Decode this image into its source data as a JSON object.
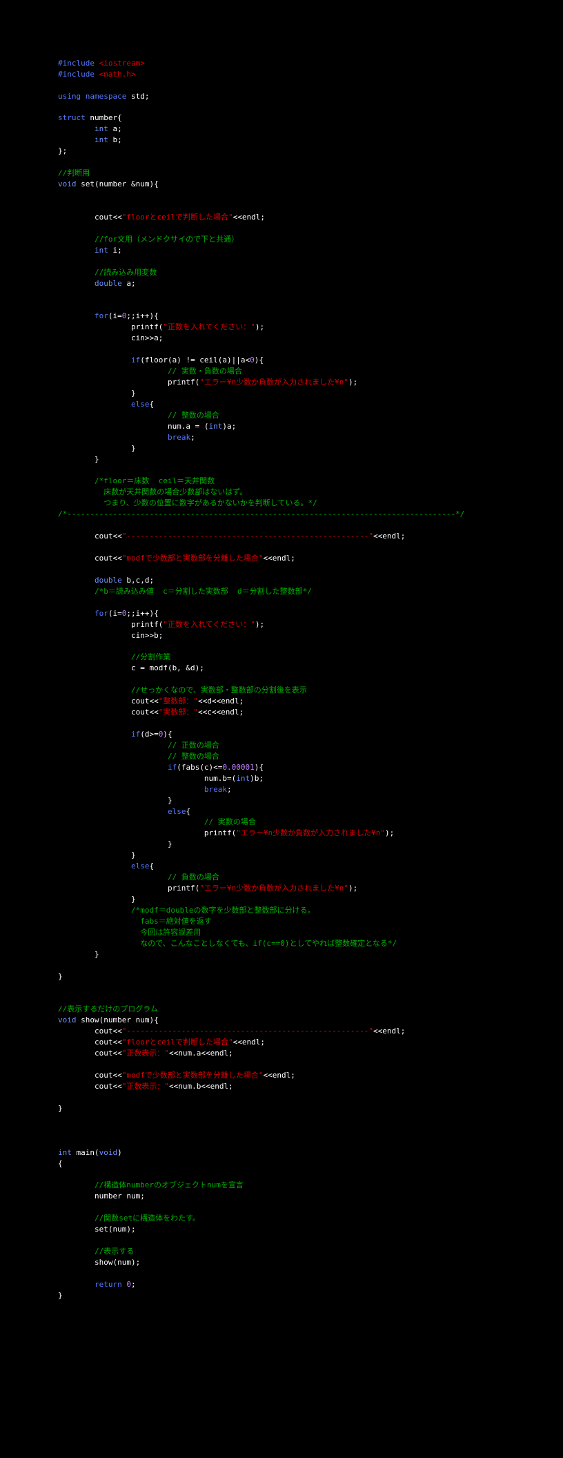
{
  "code": {
    "lines": [
      [
        {
          "c": "kw",
          "t": "#include"
        },
        {
          "c": "pl",
          "t": " "
        },
        {
          "c": "str",
          "t": "<iostream>"
        }
      ],
      [
        {
          "c": "kw",
          "t": "#include"
        },
        {
          "c": "pl",
          "t": " "
        },
        {
          "c": "str",
          "t": "<math.h>"
        }
      ],
      [],
      [
        {
          "c": "kw",
          "t": "using"
        },
        {
          "c": "pl",
          "t": " "
        },
        {
          "c": "kw",
          "t": "namespace"
        },
        {
          "c": "pl",
          "t": " std;"
        }
      ],
      [],
      [
        {
          "c": "kw",
          "t": "struct"
        },
        {
          "c": "pl",
          "t": " number{"
        }
      ],
      [
        {
          "c": "pl",
          "t": "        "
        },
        {
          "c": "kw2",
          "t": "int"
        },
        {
          "c": "pl",
          "t": " a;"
        }
      ],
      [
        {
          "c": "pl",
          "t": "        "
        },
        {
          "c": "kw2",
          "t": "int"
        },
        {
          "c": "pl",
          "t": " b;"
        }
      ],
      [
        {
          "c": "pl",
          "t": "};"
        }
      ],
      [],
      [
        {
          "c": "cmt",
          "t": "//判断用"
        }
      ],
      [
        {
          "c": "kw2",
          "t": "void"
        },
        {
          "c": "pl",
          "t": " set(number &num){"
        }
      ],
      [],
      [],
      [
        {
          "c": "pl",
          "t": "        cout<<"
        },
        {
          "c": "str",
          "t": "\"floorとceilで判断した場合\""
        },
        {
          "c": "pl",
          "t": "<<endl;"
        }
      ],
      [],
      [
        {
          "c": "pl",
          "t": "        "
        },
        {
          "c": "cmt",
          "t": "//for文用（メンドクサイので下と共通）"
        }
      ],
      [
        {
          "c": "pl",
          "t": "        "
        },
        {
          "c": "kw2",
          "t": "int"
        },
        {
          "c": "pl",
          "t": " i;"
        }
      ],
      [],
      [
        {
          "c": "pl",
          "t": "        "
        },
        {
          "c": "cmt",
          "t": "//読み込み用変数"
        }
      ],
      [
        {
          "c": "pl",
          "t": "        "
        },
        {
          "c": "kw2",
          "t": "double"
        },
        {
          "c": "pl",
          "t": " a;"
        }
      ],
      [],
      [],
      [
        {
          "c": "pl",
          "t": "        "
        },
        {
          "c": "kw",
          "t": "for"
        },
        {
          "c": "pl",
          "t": "(i="
        },
        {
          "c": "lit",
          "t": "0"
        },
        {
          "c": "pl",
          "t": ";;i++){"
        }
      ],
      [
        {
          "c": "pl",
          "t": "                printf("
        },
        {
          "c": "str",
          "t": "\"正数を入れてください：\""
        },
        {
          "c": "pl",
          "t": ");"
        }
      ],
      [
        {
          "c": "pl",
          "t": "                cin>>a;"
        }
      ],
      [],
      [
        {
          "c": "pl",
          "t": "                "
        },
        {
          "c": "kw",
          "t": "if"
        },
        {
          "c": "pl",
          "t": "(floor(a) != ceil(a)||a<"
        },
        {
          "c": "lit",
          "t": "0"
        },
        {
          "c": "pl",
          "t": "){"
        }
      ],
      [
        {
          "c": "pl",
          "t": "                        "
        },
        {
          "c": "cmt",
          "t": "// 実数・負数の場合"
        }
      ],
      [
        {
          "c": "pl",
          "t": "                        printf("
        },
        {
          "c": "str",
          "t": "\"エラー¥n少数か負数が入力されました¥n\""
        },
        {
          "c": "pl",
          "t": ");"
        }
      ],
      [
        {
          "c": "pl",
          "t": "                }"
        }
      ],
      [
        {
          "c": "pl",
          "t": "                "
        },
        {
          "c": "kw",
          "t": "else"
        },
        {
          "c": "pl",
          "t": "{"
        }
      ],
      [
        {
          "c": "pl",
          "t": "                        "
        },
        {
          "c": "cmt",
          "t": "// 整数の場合"
        }
      ],
      [
        {
          "c": "pl",
          "t": "                        num.a = ("
        },
        {
          "c": "kw2",
          "t": "int"
        },
        {
          "c": "pl",
          "t": ")a;"
        }
      ],
      [
        {
          "c": "pl",
          "t": "                        "
        },
        {
          "c": "kw",
          "t": "break"
        },
        {
          "c": "pl",
          "t": ";"
        }
      ],
      [
        {
          "c": "pl",
          "t": "                }"
        }
      ],
      [
        {
          "c": "pl",
          "t": "        }"
        }
      ],
      [],
      [
        {
          "c": "pl",
          "t": "        "
        },
        {
          "c": "cmt",
          "t": "/*floor＝床数  ceil＝天井関数"
        }
      ],
      [
        {
          "c": "cmt",
          "t": "          床数が天井関数の場合少数部はないはず。"
        }
      ],
      [
        {
          "c": "cmt",
          "t": "          つまり、少数の位置に数字があるかないかを判断している。*/"
        }
      ],
      [
        {
          "c": "cmt",
          "t": "/*-------------------------------------------------------------------------------------*/"
        }
      ],
      [],
      [
        {
          "c": "pl",
          "t": "        cout<<"
        },
        {
          "c": "str",
          "t": "\"-----------------------------------------------------\""
        },
        {
          "c": "pl",
          "t": "<<endl;"
        }
      ],
      [],
      [
        {
          "c": "pl",
          "t": "        cout<<"
        },
        {
          "c": "str",
          "t": "\"modfで少数部と実数部を分離した場合\""
        },
        {
          "c": "pl",
          "t": "<<endl;"
        }
      ],
      [],
      [
        {
          "c": "pl",
          "t": "        "
        },
        {
          "c": "kw2",
          "t": "double"
        },
        {
          "c": "pl",
          "t": " b,c,d;"
        }
      ],
      [
        {
          "c": "pl",
          "t": "        "
        },
        {
          "c": "cmt",
          "t": "/*b＝読み込み値  c＝分割した実数部  d＝分割した整数部*/"
        }
      ],
      [],
      [
        {
          "c": "pl",
          "t": "        "
        },
        {
          "c": "kw",
          "t": "for"
        },
        {
          "c": "pl",
          "t": "(i="
        },
        {
          "c": "lit",
          "t": "0"
        },
        {
          "c": "pl",
          "t": ";;i++){"
        }
      ],
      [
        {
          "c": "pl",
          "t": "                printf("
        },
        {
          "c": "str",
          "t": "\"正数を入れてください：\""
        },
        {
          "c": "pl",
          "t": ");"
        }
      ],
      [
        {
          "c": "pl",
          "t": "                cin>>b;"
        }
      ],
      [],
      [
        {
          "c": "pl",
          "t": "                "
        },
        {
          "c": "cmt",
          "t": "//分割作業"
        }
      ],
      [
        {
          "c": "pl",
          "t": "                c = modf(b, &d);"
        }
      ],
      [],
      [
        {
          "c": "pl",
          "t": "                "
        },
        {
          "c": "cmt",
          "t": "//せっかくなので、実数部・整数部の分割後を表示"
        }
      ],
      [
        {
          "c": "pl",
          "t": "                cout<<"
        },
        {
          "c": "str",
          "t": "\"整数部：\""
        },
        {
          "c": "pl",
          "t": "<<d<<endl;"
        }
      ],
      [
        {
          "c": "pl",
          "t": "                cout<<"
        },
        {
          "c": "str",
          "t": "\"実数部：\""
        },
        {
          "c": "pl",
          "t": "<<c<<endl;"
        }
      ],
      [],
      [
        {
          "c": "pl",
          "t": "                "
        },
        {
          "c": "kw",
          "t": "if"
        },
        {
          "c": "pl",
          "t": "(d>="
        },
        {
          "c": "lit",
          "t": "0"
        },
        {
          "c": "pl",
          "t": "){"
        }
      ],
      [
        {
          "c": "pl",
          "t": "                        "
        },
        {
          "c": "cmt",
          "t": "// 正数の場合"
        }
      ],
      [
        {
          "c": "pl",
          "t": "                        "
        },
        {
          "c": "cmt",
          "t": "// 整数の場合"
        }
      ],
      [
        {
          "c": "pl",
          "t": "                        "
        },
        {
          "c": "kw",
          "t": "if"
        },
        {
          "c": "pl",
          "t": "(fabs(c)<="
        },
        {
          "c": "lit",
          "t": "0.00001"
        },
        {
          "c": "pl",
          "t": "){"
        }
      ],
      [
        {
          "c": "pl",
          "t": "                                num.b=("
        },
        {
          "c": "kw2",
          "t": "int"
        },
        {
          "c": "pl",
          "t": ")b;"
        }
      ],
      [
        {
          "c": "pl",
          "t": "                                "
        },
        {
          "c": "kw",
          "t": "break"
        },
        {
          "c": "pl",
          "t": ";"
        }
      ],
      [
        {
          "c": "pl",
          "t": "                        }"
        }
      ],
      [
        {
          "c": "pl",
          "t": "                        "
        },
        {
          "c": "kw",
          "t": "else"
        },
        {
          "c": "pl",
          "t": "{"
        }
      ],
      [
        {
          "c": "pl",
          "t": "                                "
        },
        {
          "c": "cmt",
          "t": "// 実数の場合"
        }
      ],
      [
        {
          "c": "pl",
          "t": "                                printf("
        },
        {
          "c": "str",
          "t": "\"エラー¥n少数か負数が入力されました¥n\""
        },
        {
          "c": "pl",
          "t": ");"
        }
      ],
      [
        {
          "c": "pl",
          "t": "                        }"
        }
      ],
      [
        {
          "c": "pl",
          "t": "                }"
        }
      ],
      [
        {
          "c": "pl",
          "t": "                "
        },
        {
          "c": "kw",
          "t": "else"
        },
        {
          "c": "pl",
          "t": "{"
        }
      ],
      [
        {
          "c": "pl",
          "t": "                        "
        },
        {
          "c": "cmt",
          "t": "// 負数の場合"
        }
      ],
      [
        {
          "c": "pl",
          "t": "                        printf("
        },
        {
          "c": "str",
          "t": "\"エラー¥n少数か負数が入力されました¥n\""
        },
        {
          "c": "pl",
          "t": ");"
        }
      ],
      [
        {
          "c": "pl",
          "t": "                }"
        }
      ],
      [
        {
          "c": "pl",
          "t": "                "
        },
        {
          "c": "cmt",
          "t": "/*modf＝doubleの数字を少数部と整数部に分ける。"
        }
      ],
      [
        {
          "c": "cmt",
          "t": "                  fabs＝絶対値を返す"
        }
      ],
      [
        {
          "c": "cmt",
          "t": "                  今回は許容誤差用"
        }
      ],
      [
        {
          "c": "cmt",
          "t": "                  なので、こんなことしなくても、if(c==0)としてやれば整数確定となる*/"
        }
      ],
      [
        {
          "c": "pl",
          "t": "        }"
        }
      ],
      [],
      [
        {
          "c": "pl",
          "t": "}"
        }
      ],
      [],
      [],
      [
        {
          "c": "cmt",
          "t": "//表示するだけのプログラム"
        }
      ],
      [
        {
          "c": "kw2",
          "t": "void"
        },
        {
          "c": "pl",
          "t": " show(number num){"
        }
      ],
      [
        {
          "c": "pl",
          "t": "        cout<<"
        },
        {
          "c": "str",
          "t": "\"-----------------------------------------------------\""
        },
        {
          "c": "pl",
          "t": "<<endl;"
        }
      ],
      [
        {
          "c": "pl",
          "t": "        cout<<"
        },
        {
          "c": "str",
          "t": "\"floorとceilで判断した場合\""
        },
        {
          "c": "pl",
          "t": "<<endl;"
        }
      ],
      [
        {
          "c": "pl",
          "t": "        cout<<"
        },
        {
          "c": "str",
          "t": "\"正数表示：\""
        },
        {
          "c": "pl",
          "t": "<<num.a<<endl;"
        }
      ],
      [],
      [
        {
          "c": "pl",
          "t": "        cout<<"
        },
        {
          "c": "str",
          "t": "\"modfで少数部と実数部を分離した場合\""
        },
        {
          "c": "pl",
          "t": "<<endl;"
        }
      ],
      [
        {
          "c": "pl",
          "t": "        cout<<"
        },
        {
          "c": "str",
          "t": "\"正数表示：\""
        },
        {
          "c": "pl",
          "t": "<<num.b<<endl;"
        }
      ],
      [],
      [
        {
          "c": "pl",
          "t": "}"
        }
      ],
      [],
      [],
      [],
      [
        {
          "c": "kw2",
          "t": "int"
        },
        {
          "c": "pl",
          "t": " main("
        },
        {
          "c": "kw2",
          "t": "void"
        },
        {
          "c": "pl",
          "t": ")"
        }
      ],
      [
        {
          "c": "pl",
          "t": "{"
        }
      ],
      [],
      [
        {
          "c": "pl",
          "t": "        "
        },
        {
          "c": "cmt",
          "t": "//構造体numberのオブジェクトnumを宣言"
        }
      ],
      [
        {
          "c": "pl",
          "t": "        number num;"
        }
      ],
      [],
      [
        {
          "c": "pl",
          "t": "        "
        },
        {
          "c": "cmt",
          "t": "//関数setに構造体をわたす。"
        }
      ],
      [
        {
          "c": "pl",
          "t": "        set(num);"
        }
      ],
      [],
      [
        {
          "c": "pl",
          "t": "        "
        },
        {
          "c": "cmt",
          "t": "//表示する"
        }
      ],
      [
        {
          "c": "pl",
          "t": "        show(num);"
        }
      ],
      [],
      [
        {
          "c": "pl",
          "t": "        "
        },
        {
          "c": "kw",
          "t": "return"
        },
        {
          "c": "pl",
          "t": " "
        },
        {
          "c": "lit",
          "t": "0"
        },
        {
          "c": "pl",
          "t": ";"
        }
      ],
      [
        {
          "c": "pl",
          "t": "}"
        }
      ]
    ]
  }
}
